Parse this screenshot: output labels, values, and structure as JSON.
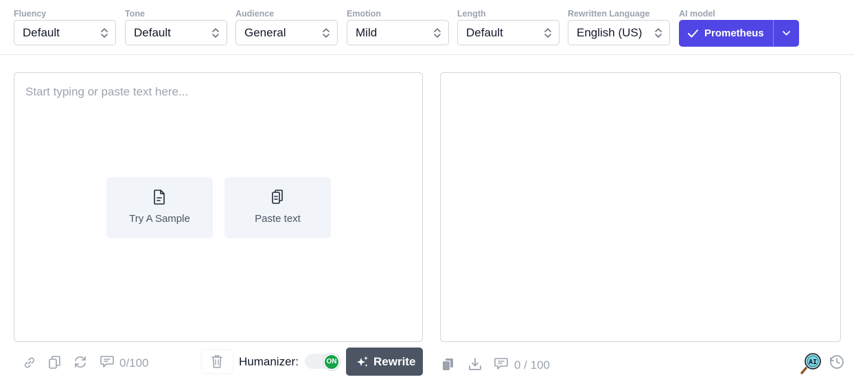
{
  "options": {
    "fluency": {
      "label": "Fluency",
      "value": "Default"
    },
    "tone": {
      "label": "Tone",
      "value": "Default"
    },
    "audience": {
      "label": "Audience",
      "value": "General"
    },
    "emotion": {
      "label": "Emotion",
      "value": "Mild"
    },
    "length": {
      "label": "Length",
      "value": "Default"
    },
    "language": {
      "label": "Rewritten Language",
      "value": "English (US)"
    },
    "model": {
      "label": "AI model",
      "value": "Prometheus"
    }
  },
  "editor": {
    "placeholder": "Start typing or paste text here...",
    "sample_label": "Try A Sample",
    "paste_label": "Paste text"
  },
  "left_toolbar": {
    "counter": "0/100",
    "humanizer_label": "Humanizer:",
    "toggle_state": "ON",
    "rewrite_label": "Rewrite"
  },
  "right_toolbar": {
    "counter": "0 / 100",
    "ai_badge": "AI"
  },
  "colors": {
    "accent": "#5046e5",
    "toggle_on": "#16a34a",
    "rewrite_bg": "#4b5563",
    "quick_bg": "#f1f4f8"
  },
  "icons": [
    "chevron-up-down-icon",
    "check-icon",
    "chevron-down-icon",
    "document-icon",
    "clipboard-icon",
    "link-icon",
    "copy-icon",
    "refresh-icon",
    "comment-icon",
    "trash-icon",
    "sparkles-icon",
    "download-icon",
    "ai-detector-icon",
    "history-icon"
  ]
}
